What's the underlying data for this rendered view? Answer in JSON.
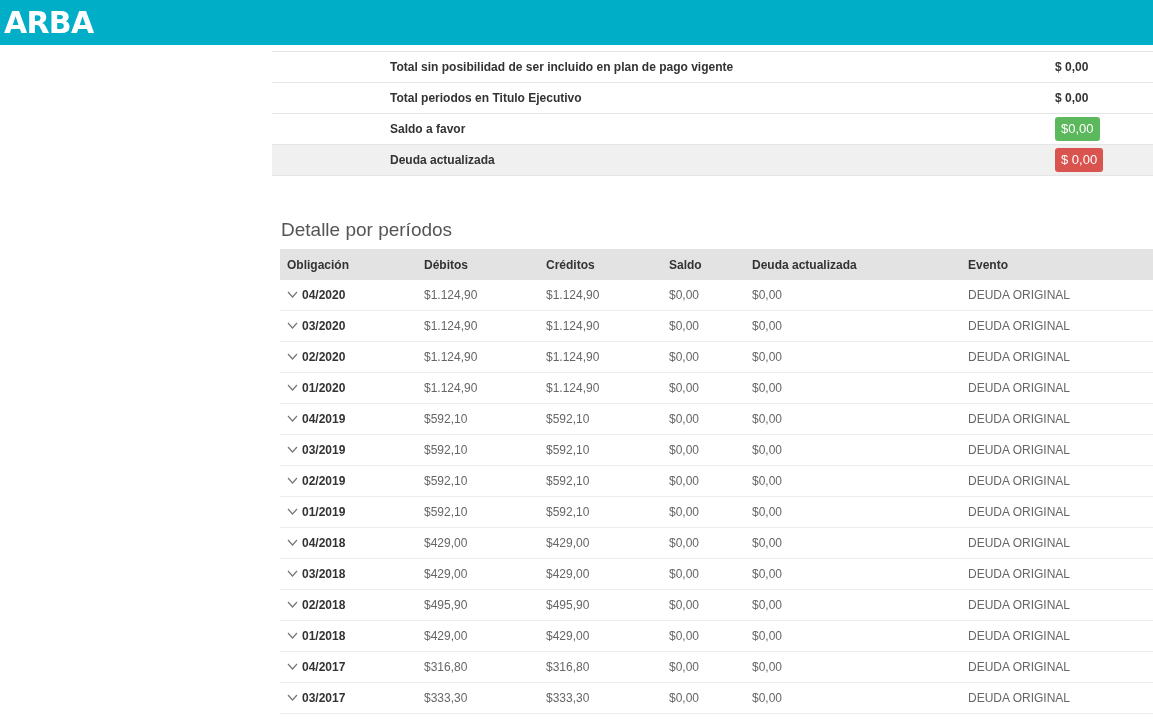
{
  "header": {
    "logo": "ARBA"
  },
  "summary": [
    {
      "label": "Total sin posibilidad de ser incluido en plan de pago vigente",
      "value": "$ 0,00",
      "kind": "plain",
      "highlighted": false
    },
    {
      "label": "Total periodos en Titulo Ejecutivo",
      "value": "$ 0,00",
      "kind": "plain",
      "highlighted": false
    },
    {
      "label": "Saldo a favor",
      "value": "$0,00",
      "kind": "badge",
      "color": "#5cb85c",
      "highlighted": false
    },
    {
      "label": "Deuda actualizada",
      "value": "$ 0,00",
      "kind": "badge",
      "color": "#d9534f",
      "highlighted": true
    }
  ],
  "detail": {
    "title": "Detalle por períodos",
    "columns": [
      "Obligación",
      "Débitos",
      "Créditos",
      "Saldo",
      "Deuda actualizada",
      "Evento"
    ],
    "rows": [
      {
        "expanded": false,
        "cells": [
          "04/2020",
          "$1.124,90",
          "$1.124,90",
          "$0,00",
          "$0,00",
          "DEUDA ORIGINAL"
        ]
      },
      {
        "expanded": false,
        "cells": [
          "03/2020",
          "$1.124,90",
          "$1.124,90",
          "$0,00",
          "$0,00",
          "DEUDA ORIGINAL"
        ]
      },
      {
        "expanded": false,
        "cells": [
          "02/2020",
          "$1.124,90",
          "$1.124,90",
          "$0,00",
          "$0,00",
          "DEUDA ORIGINAL"
        ]
      },
      {
        "expanded": false,
        "cells": [
          "01/2020",
          "$1.124,90",
          "$1.124,90",
          "$0,00",
          "$0,00",
          "DEUDA ORIGINAL"
        ]
      },
      {
        "expanded": false,
        "cells": [
          "04/2019",
          "$592,10",
          "$592,10",
          "$0,00",
          "$0,00",
          "DEUDA ORIGINAL"
        ]
      },
      {
        "expanded": false,
        "cells": [
          "03/2019",
          "$592,10",
          "$592,10",
          "$0,00",
          "$0,00",
          "DEUDA ORIGINAL"
        ]
      },
      {
        "expanded": false,
        "cells": [
          "02/2019",
          "$592,10",
          "$592,10",
          "$0,00",
          "$0,00",
          "DEUDA ORIGINAL"
        ]
      },
      {
        "expanded": false,
        "cells": [
          "01/2019",
          "$592,10",
          "$592,10",
          "$0,00",
          "$0,00",
          "DEUDA ORIGINAL"
        ]
      },
      {
        "expanded": false,
        "cells": [
          "04/2018",
          "$429,00",
          "$429,00",
          "$0,00",
          "$0,00",
          "DEUDA ORIGINAL"
        ]
      },
      {
        "expanded": false,
        "cells": [
          "03/2018",
          "$429,00",
          "$429,00",
          "$0,00",
          "$0,00",
          "DEUDA ORIGINAL"
        ]
      },
      {
        "expanded": false,
        "cells": [
          "02/2018",
          "$495,90",
          "$495,90",
          "$0,00",
          "$0,00",
          "DEUDA ORIGINAL"
        ]
      },
      {
        "expanded": false,
        "cells": [
          "01/2018",
          "$429,00",
          "$429,00",
          "$0,00",
          "$0,00",
          "DEUDA ORIGINAL"
        ]
      },
      {
        "expanded": false,
        "cells": [
          "04/2017",
          "$316,80",
          "$316,80",
          "$0,00",
          "$0,00",
          "DEUDA ORIGINAL"
        ]
      },
      {
        "expanded": false,
        "cells": [
          "03/2017",
          "$333,30",
          "$333,30",
          "$0,00",
          "$0,00",
          "DEUDA ORIGINAL"
        ]
      }
    ]
  }
}
